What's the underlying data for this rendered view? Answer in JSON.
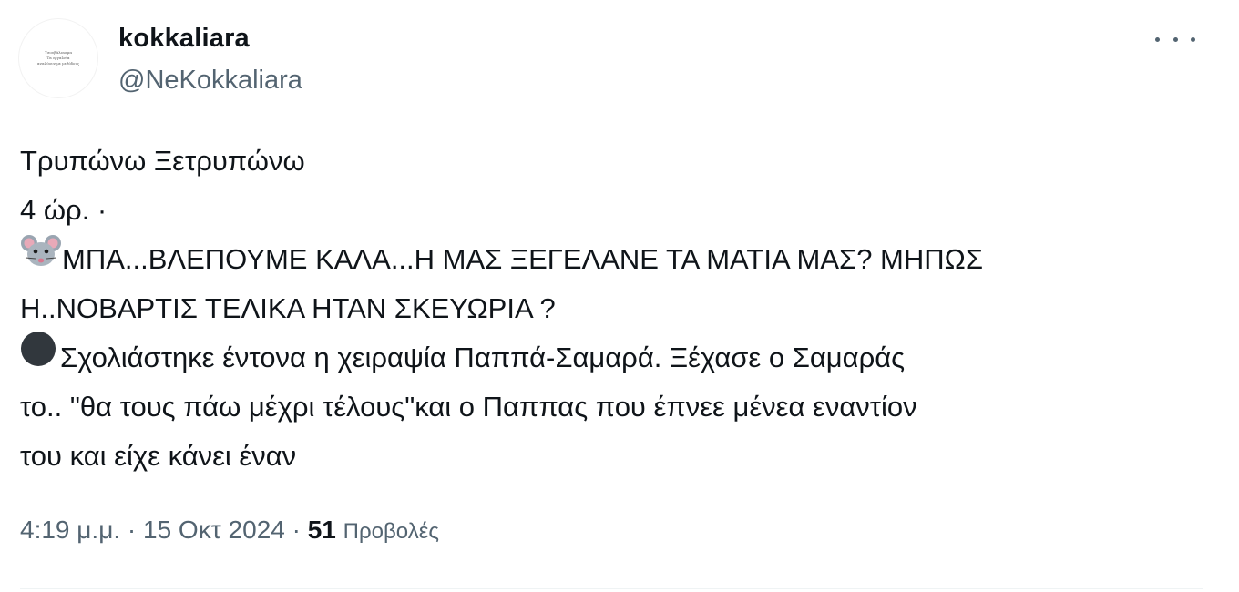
{
  "author": {
    "display_name": "kokkaliara",
    "handle": "@NeKokkaliara",
    "avatar_text": [
      "Τσουβάλιασμα",
      "Τα εργαλεία",
      "αναλύουν με μεθόδους"
    ]
  },
  "tweet": {
    "lines": [
      "Τρυπώνω Ξετρυπώνω",
      "4 ώρ.  ·",
      "ΜΠΑ...ΒΛΕΠΟΥΜΕ ΚΑΛΑ...Η  ΜΑΣ ΞΕΓΕΛΑΝΕ ΤΑ ΜΑΤΙΑ ΜΑΣ? ΜΗΠΩΣ",
      "Η..ΝΟΒΑΡΤΙΣ ΤΕΛΙΚΑ ΗΤΑΝ ΣΚΕΥΩΡΙΑ ?",
      "Σχολιάστηκε έντονα η χειραψία Παππά-Σαμαρά. Ξέχασε ο Σαμαράς",
      "το.. \"θα τους πάω μέχρι τέλους\"και ο Παππας που έπνεε μένεα εναντίον",
      "του και είχε κάνει  έναν"
    ],
    "emoji": {
      "line3": "mouse-face-icon",
      "line5": "black-circle-icon"
    }
  },
  "meta": {
    "time": "4:19 μ.μ.",
    "separator": "·",
    "date": "15 Οκτ 2024",
    "views_count": "51",
    "views_label": "Προβολές"
  },
  "colors": {
    "text": "#0f1419",
    "secondary": "#536471",
    "divider": "#eff3f4"
  }
}
